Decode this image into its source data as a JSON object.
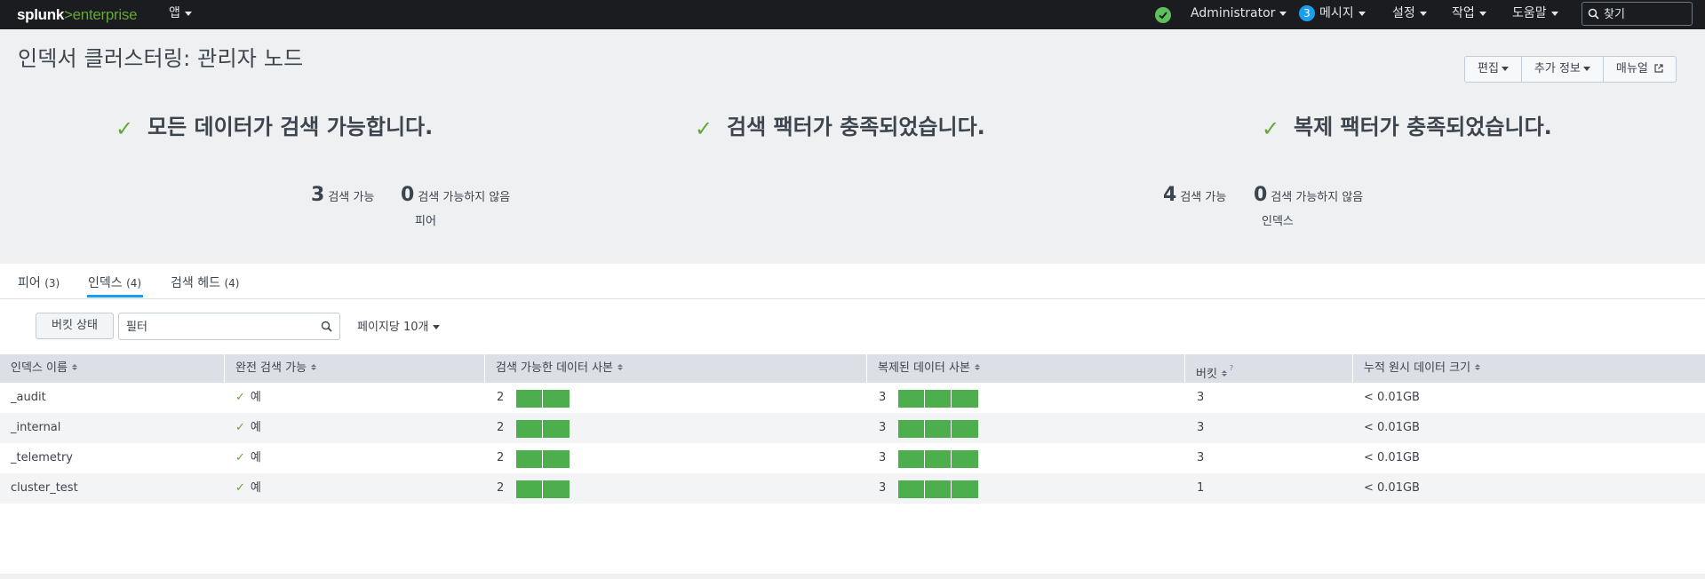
{
  "nav": {
    "logo_brand": "splunk",
    "logo_gt": ">",
    "logo_product": "enterprise",
    "apps_label": "앱",
    "user_label": "Administrator",
    "messages_count": "3",
    "messages_label": "메시지",
    "settings_label": "설정",
    "activity_label": "작업",
    "help_label": "도움말",
    "find_placeholder": "찾기",
    "status_icon": "check-circle-icon"
  },
  "page": {
    "title": "인덱서 클러스터링: 관리자 노드",
    "buttons": {
      "edit": "편집",
      "more_info": "추가 정보",
      "docs": "매뉴얼"
    }
  },
  "summaries": [
    {
      "text": "모든 데이터가 검색 가능합니다."
    },
    {
      "text": "검색 팩터가 충족되었습니다."
    },
    {
      "text": "복제 팩터가 충족되었습니다."
    }
  ],
  "peer_stats": {
    "searchable_count": "3",
    "searchable_label": "검색 가능",
    "not_searchable_count": "0",
    "not_searchable_label": "검색 가능하지 않음",
    "caption": "피어"
  },
  "index_stats": {
    "searchable_count": "4",
    "searchable_label": "검색 가능",
    "not_searchable_count": "0",
    "not_searchable_label": "검색 가능하지 않음",
    "caption": "인덱스"
  },
  "tabs": [
    {
      "label": "피어",
      "count": "(3)"
    },
    {
      "label": "인덱스",
      "count": "(4)"
    },
    {
      "label": "검색 헤드",
      "count": "(4)"
    }
  ],
  "controls": {
    "bucket_status": "버킷 상태",
    "filter_placeholder": "필터",
    "per_page": "페이지당 10개"
  },
  "table": {
    "headers": [
      "인덱스 이름",
      "완전 검색 가능",
      "검색 가능한 데이터 사본",
      "복제된 데이터 사본",
      "버킷",
      "누적 원시 데이터 크기"
    ],
    "header_note": "?",
    "rows": [
      {
        "name": "_audit",
        "searchable": "예",
        "search_copies": "2",
        "rep_copies": "3",
        "buckets": "3",
        "size": "< 0.01GB"
      },
      {
        "name": "_internal",
        "searchable": "예",
        "search_copies": "2",
        "rep_copies": "3",
        "buckets": "3",
        "size": "< 0.01GB"
      },
      {
        "name": "_telemetry",
        "searchable": "예",
        "search_copies": "2",
        "rep_copies": "3",
        "buckets": "3",
        "size": "< 0.01GB"
      },
      {
        "name": "cluster_test",
        "searchable": "예",
        "search_copies": "2",
        "rep_copies": "3",
        "buckets": "1",
        "size": "< 0.01GB"
      }
    ]
  },
  "colors": {
    "accent": "#1a9ff0",
    "ok": "#65a637",
    "bar": "#4cae4c",
    "nav_bg": "#1a1c20"
  }
}
